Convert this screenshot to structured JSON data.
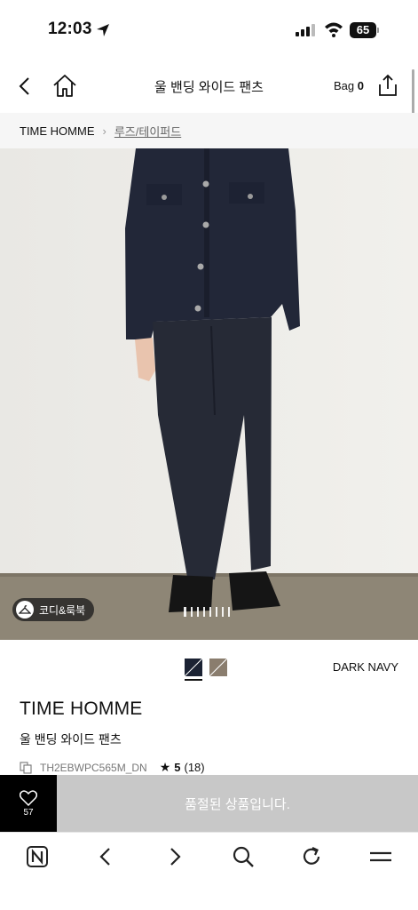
{
  "status_bar": {
    "time": "12:03",
    "battery": "65"
  },
  "header": {
    "title": "울 밴딩 와이드 팬츠",
    "bag_label": "Bag",
    "bag_count": "0"
  },
  "breadcrumb": {
    "brand": "TIME HOMME",
    "category": "루즈/테이퍼드"
  },
  "gallery": {
    "lookbook_label": "코디&룩북",
    "page_count": 8,
    "current_page": 1
  },
  "colors": {
    "selected_name": "DARK NAVY",
    "swatches": [
      {
        "name": "dark-navy",
        "hex": "#1b2233",
        "selected": true
      },
      {
        "name": "brown",
        "hex": "#8a7d6e",
        "selected": false
      }
    ]
  },
  "product": {
    "brand": "TIME HOMME",
    "name": "울 밴딩 와이드 팬츠",
    "code": "TH2EBWPC565M_DN",
    "rating": "5",
    "review_count": "(18)"
  },
  "actions": {
    "like_count": "57",
    "soldout_label": "품절된 상품입니다."
  },
  "browser_bar": {
    "icons": [
      "naver-icon",
      "back-icon",
      "forward-icon",
      "search-icon",
      "refresh-icon",
      "menu-icon"
    ]
  },
  "theme": {
    "accent": "#000000",
    "disabled": "#c8c8c8",
    "breadcrumb_bg": "#f6f6f6"
  }
}
